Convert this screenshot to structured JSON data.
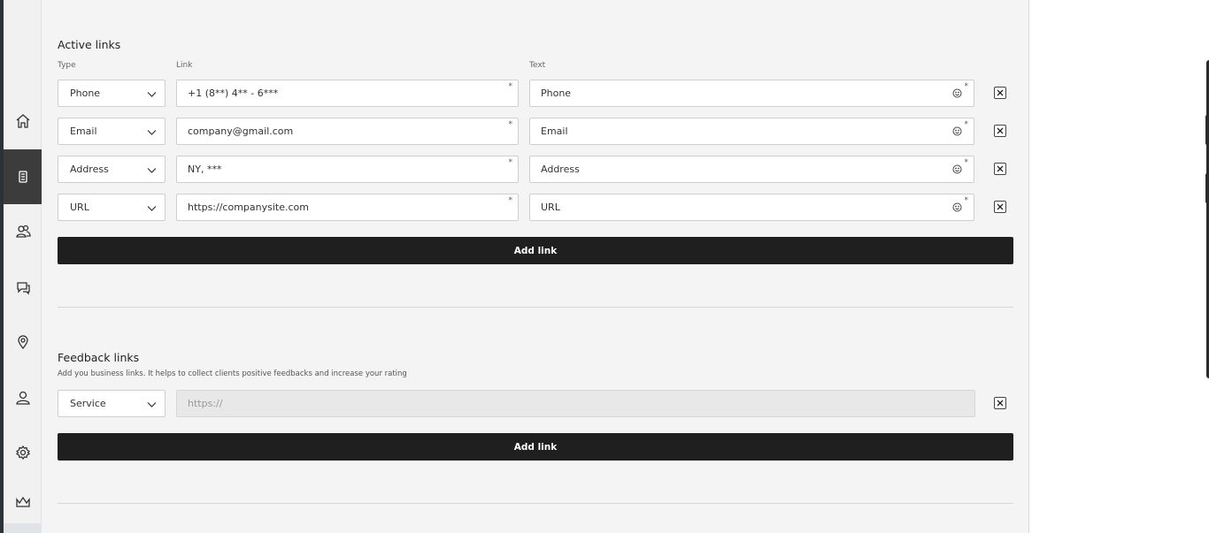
{
  "sidebar": {
    "items": [
      {
        "name": "home",
        "icon": "home-icon"
      },
      {
        "name": "business-card",
        "icon": "card-icon",
        "active": true
      },
      {
        "name": "users",
        "icon": "users-icon"
      },
      {
        "name": "chat",
        "icon": "chat-icon"
      },
      {
        "name": "location",
        "icon": "location-icon"
      },
      {
        "name": "profile",
        "icon": "user-icon"
      },
      {
        "name": "settings",
        "icon": "gear-icon"
      },
      {
        "name": "premium",
        "icon": "crown-icon"
      }
    ]
  },
  "active_links": {
    "title": "Active links",
    "col_type": "Type",
    "col_link": "Link",
    "col_text": "Text",
    "rows": [
      {
        "type": "Phone",
        "link": "+1 (8**) 4** - 6***",
        "text": "Phone"
      },
      {
        "type": "Email",
        "link": "company@gmail.com",
        "text": "Email"
      },
      {
        "type": "Address",
        "link": "NY, ***",
        "text": "Address"
      },
      {
        "type": "URL",
        "link": "https://companysite.com",
        "text": "URL"
      }
    ],
    "required_mark": "*",
    "add_label": "Add link"
  },
  "feedback_links": {
    "title": "Feedback links",
    "description": "Add you business links. It helps to collect clients positive feedbacks and increase your rating",
    "rows": [
      {
        "type": "Service",
        "placeholder": "https://"
      }
    ],
    "add_label": "Add link"
  }
}
